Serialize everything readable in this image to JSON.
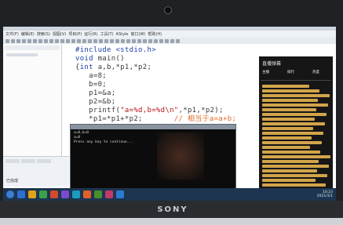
{
  "brand": "SONY",
  "ide": {
    "menu": [
      "文件(F)",
      "编辑(E)",
      "搜索(S)",
      "视图(V)",
      "项目(P)",
      "运行(R)",
      "工具(T)",
      "AStyle",
      "窗口(W)",
      "帮助(H)"
    ],
    "bottom_panel_label": "已完成"
  },
  "code": {
    "lines": [
      [
        {
          "t": "#include <stdio.h>",
          "c": "kw"
        }
      ],
      [
        {
          "t": "void ",
          "c": "kw"
        },
        {
          "t": "main()",
          "c": "plain"
        }
      ],
      [
        {
          "t": "{",
          "c": "plain"
        },
        {
          "t": "int ",
          "c": "kw"
        },
        {
          "t": "a,b,*p1,*p2;",
          "c": "plain"
        }
      ],
      [
        {
          "t": "   a=8;",
          "c": "plain"
        }
      ],
      [
        {
          "t": "   b=0;",
          "c": "plain"
        }
      ],
      [
        {
          "t": "   p1=&a;",
          "c": "plain"
        }
      ],
      [
        {
          "t": "   p2=&b;",
          "c": "plain"
        }
      ],
      [
        {
          "t": "   printf(",
          "c": "plain"
        },
        {
          "t": "\"a=%d,b=%d\\n\"",
          "c": "str"
        },
        {
          "t": ",*p1,*p2);",
          "c": "plain"
        }
      ],
      [
        {
          "t": "   *p1=*p1+*p2;",
          "c": "plain"
        },
        {
          "t": "       // 相当于a=a+b;",
          "c": "cm"
        }
      ],
      [
        {
          "t": "   printf(",
          "c": "plain"
        },
        {
          "t": "\"a=%d\\n\"",
          "c": "str"
        },
        {
          "t": ",*p1);",
          "c": "plain"
        }
      ]
    ]
  },
  "console": {
    "lines": [
      "a=8,b=0",
      "a=8",
      "Press any key to continue..."
    ]
  },
  "side_panel": {
    "title": "直播弹幕",
    "tabs": [
      "主播",
      "排行",
      "热度"
    ]
  },
  "taskbar": {
    "icon_colors": [
      "#2d6fd1",
      "#e0a21a",
      "#3aa14a",
      "#d24a2c",
      "#7a4bd0",
      "#1c9bc1",
      "#e0612b",
      "#4a8f2c",
      "#c23a6a",
      "#2b7bd0"
    ],
    "clock": "10:23\n2021/3/1"
  }
}
